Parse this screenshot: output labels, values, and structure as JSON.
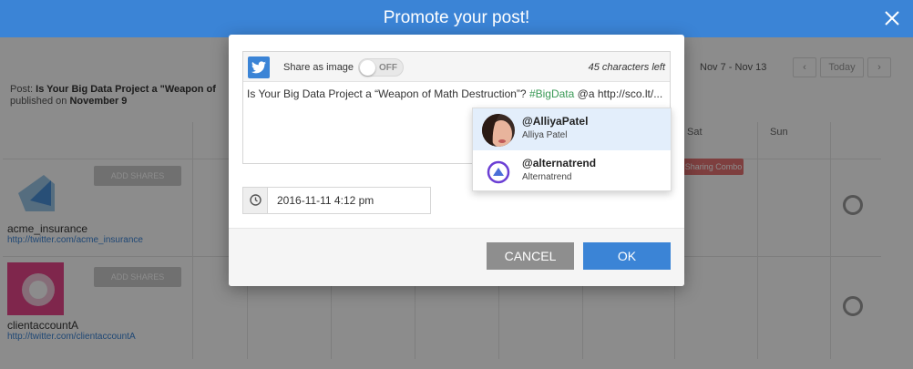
{
  "modal": {
    "title": "Promote your post!"
  },
  "background": {
    "post_prefix": "Post:",
    "post_title": "Is Your Big Data Project a \"Weapon of",
    "published_prefix": "published on",
    "published_date": "November 9",
    "date_range": "Nov 7 - Nov 13",
    "today_label": "Today",
    "columns": [
      "Sat",
      "Sun"
    ],
    "add_button": "ADD SHARES",
    "badge": "Sharing Combo",
    "accounts": [
      {
        "name": "acme_insurance",
        "link": "http://twitter.com/acme_insurance"
      },
      {
        "name": "clientaccountA",
        "link": "http://twitter.com/clientaccountA"
      }
    ]
  },
  "composer": {
    "network_icon": "twitter-icon",
    "share_as_image_label": "Share as image",
    "toggle_state": "OFF",
    "chars_left": "45 characters left",
    "tweet_before": "Is Your Big Data Project a “Weapon of Math Destruction”? ",
    "tweet_hashtag": "#BigData",
    "tweet_after": " @a http://sco.lt/..."
  },
  "schedule": {
    "icon": "clock-icon",
    "datetime": "2016-11-11 4:12 pm"
  },
  "buttons": {
    "cancel": "CANCEL",
    "ok": "OK"
  },
  "mentions": [
    {
      "handle": "@AlliyaPatel",
      "name": "Alliya Patel",
      "active": true
    },
    {
      "handle": "@alternatrend",
      "name": "Alternatrend",
      "active": false
    }
  ],
  "colors": {
    "header": "#3b84d6",
    "hashtag": "#3a9a56",
    "cancel": "#8e8e8e",
    "ok": "#3b84d6"
  }
}
